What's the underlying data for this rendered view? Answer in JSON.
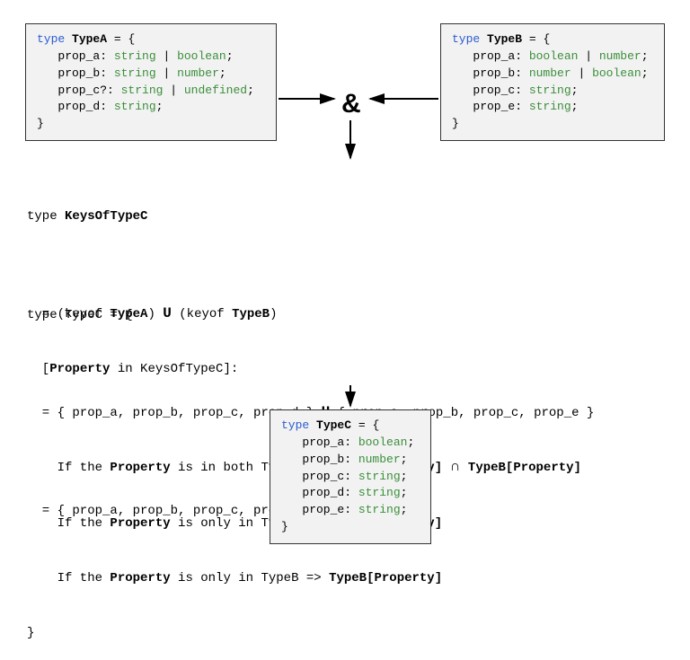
{
  "type_a": {
    "declare": "type",
    "name": "TypeA",
    "open": " = {",
    "lines": [
      {
        "prop": "prop_a",
        "opt": "",
        "types": [
          "string",
          "boolean"
        ]
      },
      {
        "prop": "prop_b",
        "opt": "",
        "types": [
          "string",
          "number"
        ]
      },
      {
        "prop": "prop_c",
        "opt": "?",
        "types": [
          "string",
          "undefined"
        ]
      },
      {
        "prop": "prop_d",
        "opt": "",
        "types": [
          "string"
        ]
      }
    ],
    "close": "}"
  },
  "type_b": {
    "declare": "type",
    "name": "TypeB",
    "open": " = {",
    "lines": [
      {
        "prop": "prop_a",
        "opt": "",
        "types": [
          "boolean",
          "number"
        ]
      },
      {
        "prop": "prop_b",
        "opt": "",
        "types": [
          "number",
          "boolean"
        ]
      },
      {
        "prop": "prop_c",
        "opt": "",
        "types": [
          "string"
        ]
      },
      {
        "prop": "prop_e",
        "opt": "",
        "types": [
          "string"
        ]
      }
    ],
    "close": "}"
  },
  "amp": "&",
  "keys": {
    "l1_a": "type ",
    "l1_b": "KeysOfTypeC",
    "l2_a": "  = (keyof ",
    "l2_b": "TypeA",
    "l2_c": ") ",
    "l2_op": "U",
    "l2_d": " (keyof ",
    "l2_e": "TypeB",
    "l2_f": ")",
    "l3_a": "  = { prop_a, prop_b, prop_c, prop_d } ",
    "l3_op": "U",
    "l3_b": " { prop_a, prop_b, prop_c, prop_e }",
    "l4": "  = { prop_a, prop_b, prop_c, prop_d, prop_e }"
  },
  "typec_decl": {
    "l1": "type TypeC = {",
    "l2_a": "  [",
    "l2_b": "Property",
    "l2_c": " in KeysOfTypeC]:",
    "r1_a": "    If the ",
    "r1_b": "Property",
    "r1_c": " is in both Types => ",
    "r1_d": "TypeA[Property]",
    "r1_op": " ∩ ",
    "r1_e": "TypeB[Property]",
    "r2_a": "    If the ",
    "r2_b": "Property",
    "r2_c": " is only in TypeA => ",
    "r2_d": "TypeA[Property]",
    "r3_a": "    If the ",
    "r3_b": "Property",
    "r3_c": " is only in TypeB => ",
    "r3_d": "TypeB[Property]",
    "close": "}"
  },
  "type_c": {
    "declare": "type",
    "name": "TypeC",
    "open": " = {",
    "lines": [
      {
        "prop": "prop_a",
        "opt": "",
        "types": [
          "boolean"
        ]
      },
      {
        "prop": "prop_b",
        "opt": "",
        "types": [
          "number"
        ]
      },
      {
        "prop": "prop_c",
        "opt": "",
        "types": [
          "string"
        ]
      },
      {
        "prop": "prop_d",
        "opt": "",
        "types": [
          "string"
        ]
      },
      {
        "prop": "prop_e",
        "opt": "",
        "types": [
          "string"
        ]
      }
    ],
    "close": "}"
  }
}
